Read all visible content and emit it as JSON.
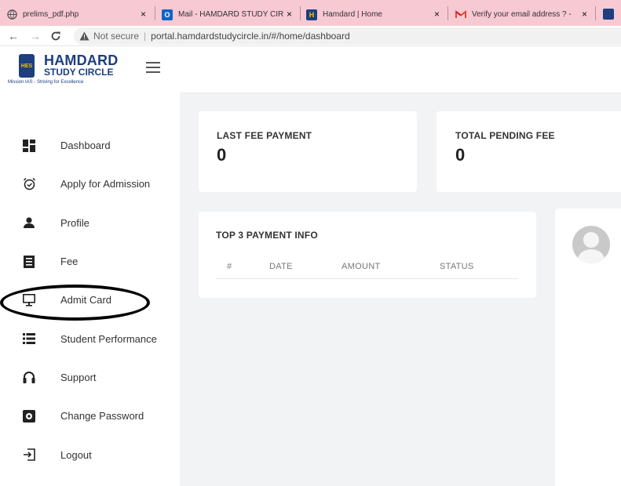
{
  "browser": {
    "tabs": [
      {
        "title": "prelims_pdf.php",
        "icon": "globe-icon"
      },
      {
        "title": "Mail - HAMDARD STUDY CIR",
        "icon": "outlook-icon"
      },
      {
        "title": "Hamdard | Home",
        "icon": "hamdard-logo-icon"
      },
      {
        "title": "Verify your email address ? -",
        "icon": "gmail-icon"
      }
    ],
    "close_glyph": "×",
    "address": {
      "security_label": "Not secure",
      "url": "portal.hamdardstudycircle.in/#/home/dashboard"
    }
  },
  "brand": {
    "name_line1": "HAMDARD",
    "name_line2": "STUDY CIRCLE",
    "tagline": "Mission IAS - Striving for Excellence",
    "logo_text": "HES"
  },
  "menu": [
    {
      "label": "Dashboard",
      "icon": "dashboard-icon"
    },
    {
      "label": "Apply for Admission",
      "icon": "alarm-clock-icon"
    },
    {
      "label": "Profile",
      "icon": "person-icon"
    },
    {
      "label": "Fee",
      "icon": "receipt-icon"
    },
    {
      "label": "Admit Card",
      "icon": "monitor-icon"
    },
    {
      "label": "Student Performance",
      "icon": "list-icon"
    },
    {
      "label": "Support",
      "icon": "headset-icon"
    },
    {
      "label": "Change Password",
      "icon": "gear-icon"
    },
    {
      "label": "Logout",
      "icon": "logout-icon"
    }
  ],
  "cards": {
    "last_fee": {
      "title": "LAST FEE PAYMENT",
      "value": "0"
    },
    "pending_fee": {
      "title": "TOTAL PENDING FEE",
      "value": "0"
    },
    "payments": {
      "title": "TOP 3 PAYMENT INFO",
      "columns": [
        "#",
        "DATE",
        "AMOUNT",
        "STATUS"
      ]
    }
  },
  "colors": {
    "tab_strip": "#f7c9d3",
    "brand_blue": "#1e3e7e",
    "content_bg": "#f2f3f5"
  }
}
